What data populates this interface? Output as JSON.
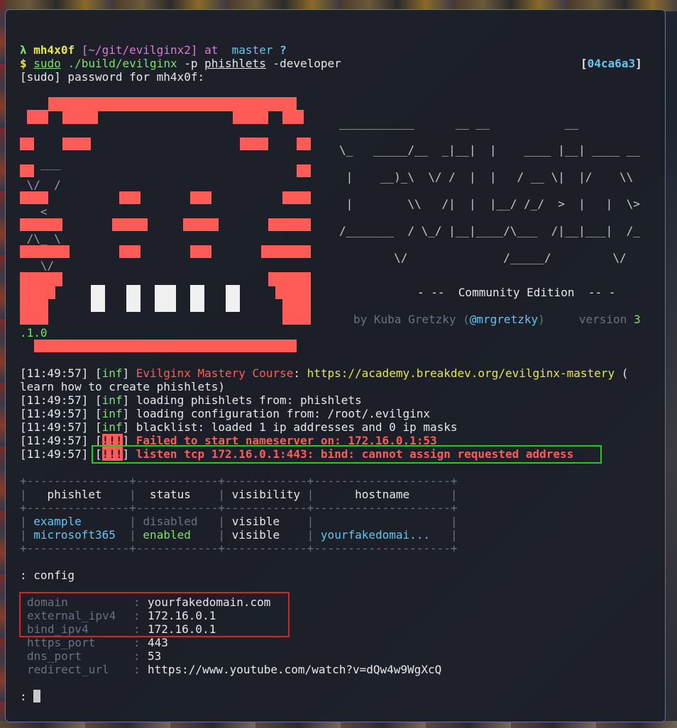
{
  "prompt": {
    "lambda": "λ",
    "user": "mh4x0f",
    "path": "[~/git/evilginx2]",
    "at": " at ",
    "branch": "master",
    "status": "?"
  },
  "command": {
    "dollar": "$",
    "sudo": "sudo",
    "binary": "./build/evilginx",
    "flag_p": "-p",
    "phishlets": "phishlets",
    "flag_dev": "-developer",
    "commit_open": "[",
    "commit": "04ca6a3",
    "commit_close": "]"
  },
  "sudo_prompt": "[sudo] password for mh4x0f:",
  "banner": {
    "ascii_lines": [
      "___________      __ __           __",
      "\\_   _____/__  _|__|  |    ____ |__| ____ __",
      " |    __)_\\  \\/ /  |  |   / __ \\|  |/    \\\\",
      " |        \\\\   /|  |  |__/ /_/  >  |   |  \\>",
      "/_______  / \\_/ |__|____/\\___  /|__|___|  /_",
      "        \\/              /_____/         \\/"
    ],
    "side_lines": [
      "_  ___",
      " \\/  /",
      "   <",
      " /\\_ \\",
      "   \\/"
    ],
    "edition": "- --  Community Edition  -- -",
    "by_prefix": "by Kuba Gretzky (",
    "handle": "@mrgretzky",
    "by_suffix": ")     version ",
    "version_major": "3",
    "version_rest": ".1.0"
  },
  "logs": {
    "l1": {
      "time": "[11:49:57]",
      "lvl": "inf",
      "title": "Evilginx Mastery Course",
      "sep": ": ",
      "url": "https://academy.breakdev.org/evilginx-mastery",
      "tail": " (",
      "wrap": "learn how to create phishlets)"
    },
    "l2": {
      "time": "[11:49:57]",
      "lvl": "inf",
      "msg": "loading phishlets from: phishlets"
    },
    "l3": {
      "time": "[11:49:57]",
      "lvl": "inf",
      "msg": "loading configuration from: /root/.evilginx"
    },
    "l4": {
      "time": "[11:49:57]",
      "lvl": "inf",
      "msg": "blacklist: loaded 1 ip addresses and 0 ip masks"
    },
    "l5": {
      "time": "[11:49:57]",
      "lvl": "!!!",
      "msg": "Failed to start nameserver on: 172.16.0.1:53"
    },
    "l6": {
      "time": "[11:49:57]",
      "lvl": "!!!",
      "msg": "listen tcp 172.16.0.1:443: bind: cannot assign requested address"
    }
  },
  "table": {
    "border": "+---------------+------------+------------+--------------------+",
    "headers": [
      "phishlet",
      "status",
      "visibility",
      "hostname"
    ],
    "rows": [
      {
        "phishlet": "example",
        "status": "disabled",
        "visibility": "visible",
        "hostname": ""
      },
      {
        "phishlet": "microsoft365",
        "status": "enabled",
        "visibility": "visible",
        "hostname": "yourfakedomai..."
      }
    ]
  },
  "config_prompt": ": config",
  "config": [
    {
      "key": "domain",
      "value": "yourfakedomain.com"
    },
    {
      "key": "external_ipv4",
      "value": "172.16.0.1"
    },
    {
      "key": "bind_ipv4",
      "value": "172.16.0.1"
    },
    {
      "key": "https_port",
      "value": "443"
    },
    {
      "key": "dns_port",
      "value": "53"
    },
    {
      "key": "redirect_url",
      "value": "https://www.youtube.com/watch?v=dQw4w9WgXcQ"
    }
  ],
  "input_prompt": ": ",
  "colors": {
    "accent_red": "#ff5c57",
    "info_green": "#7ee06e",
    "url_yellow": "#e6e64a",
    "link_cyan": "#5ec8f0",
    "highlight_green": "#22cc22",
    "highlight_red": "#e02020"
  }
}
